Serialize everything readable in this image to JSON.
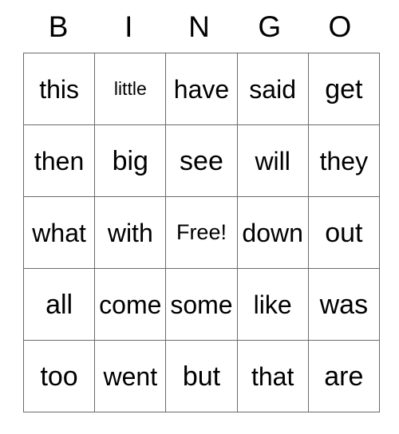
{
  "card": {
    "header": {
      "letters": [
        "B",
        "I",
        "N",
        "G",
        "O"
      ]
    },
    "grid": {
      "rows": [
        [
          "this",
          "little",
          "have",
          "said",
          "get"
        ],
        [
          "then",
          "big",
          "see",
          "will",
          "they"
        ],
        [
          "what",
          "with",
          "Free!",
          "down",
          "out"
        ],
        [
          "all",
          "come",
          "some",
          "like",
          "was"
        ],
        [
          "too",
          "went",
          "but",
          "that",
          "are"
        ]
      ]
    },
    "free_space": {
      "label": "Free!",
      "row": 2,
      "column": 2
    },
    "colors": {
      "background": "#ffffff",
      "text": "#000000",
      "grid_line": "#6b6b6b"
    }
  }
}
